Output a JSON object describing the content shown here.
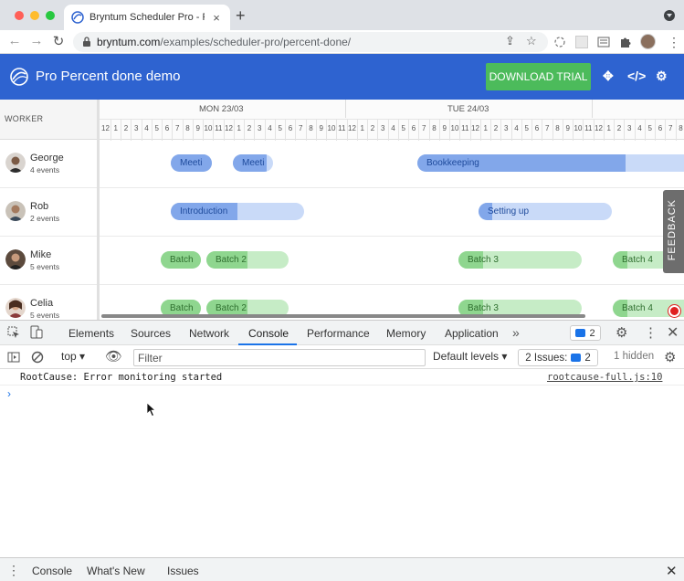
{
  "browser": {
    "tab_title": "Bryntum Scheduler Pro - Pro P",
    "url_host": "bryntum.com",
    "url_path": "/examples/scheduler-pro/percent-done/"
  },
  "app": {
    "title": "Pro Percent done demo",
    "download_label": "DOWNLOAD TRIAL",
    "brand_color": "#2e63d0",
    "download_color": "#4cbb5b"
  },
  "scheduler": {
    "worker_header": "WORKER",
    "days": [
      "MON 23/03",
      "TUE 24/03"
    ],
    "hours": [
      "12",
      "1",
      "2",
      "3",
      "4",
      "5",
      "6",
      "7",
      "8",
      "9",
      "10",
      "11",
      "12",
      "1",
      "2",
      "3",
      "4",
      "5",
      "6",
      "7",
      "8",
      "9",
      "10",
      "11",
      "12",
      "1",
      "2",
      "3",
      "4",
      "5",
      "6",
      "7",
      "8",
      "9",
      "10",
      "11",
      "12",
      "1",
      "2",
      "3",
      "4",
      "5",
      "6",
      "7",
      "8",
      "9",
      "10",
      "11",
      "12",
      "1",
      "2",
      "3",
      "4",
      "5",
      "6",
      "7",
      "8"
    ],
    "resources": [
      {
        "name": "George",
        "events": "4 events"
      },
      {
        "name": "Rob",
        "events": "2 events"
      },
      {
        "name": "Mike",
        "events": "5 events"
      },
      {
        "name": "Celia",
        "events": "5 events"
      }
    ],
    "events": [
      {
        "label": "Meeti",
        "color": "blue",
        "percent_done": 100
      },
      {
        "label": "Meeti",
        "color": "blue",
        "percent_done": 85
      },
      {
        "label": "Bookkeeping",
        "color": "blue",
        "percent_done": 78
      },
      {
        "label": "Introduction",
        "color": "blue",
        "percent_done": 50
      },
      {
        "label": "Setting up",
        "color": "blue",
        "percent_done": 10
      },
      {
        "label": "Batch",
        "color": "green",
        "percent_done": 100
      },
      {
        "label": "Batch 2",
        "color": "green",
        "percent_done": 50
      },
      {
        "label": "Batch 3",
        "color": "green",
        "percent_done": 20
      },
      {
        "label": "Batch 4",
        "color": "green",
        "percent_done": 20
      },
      {
        "label": "Batch",
        "color": "green",
        "percent_done": 100
      },
      {
        "label": "Batch 2",
        "color": "green",
        "percent_done": 50
      },
      {
        "label": "Batch 3",
        "color": "green",
        "percent_done": 20
      },
      {
        "label": "Batch 4",
        "color": "green",
        "percent_done": 20
      }
    ],
    "feedback_label": "FEEDBACK"
  },
  "devtools": {
    "tabs": [
      "Elements",
      "Sources",
      "Network",
      "Console",
      "Performance",
      "Memory",
      "Application"
    ],
    "active_tab": "Console",
    "message_count": "2",
    "context": "top",
    "filter_placeholder": "Filter",
    "levels": "Default levels",
    "issues_label": "2 Issues:",
    "issues_count": "2",
    "hidden": "1 hidden",
    "console_message": "RootCause: Error monitoring started",
    "console_source": "rootcause-full.js:10",
    "drawer_tabs": [
      "Console",
      "What's New",
      "Issues"
    ]
  }
}
